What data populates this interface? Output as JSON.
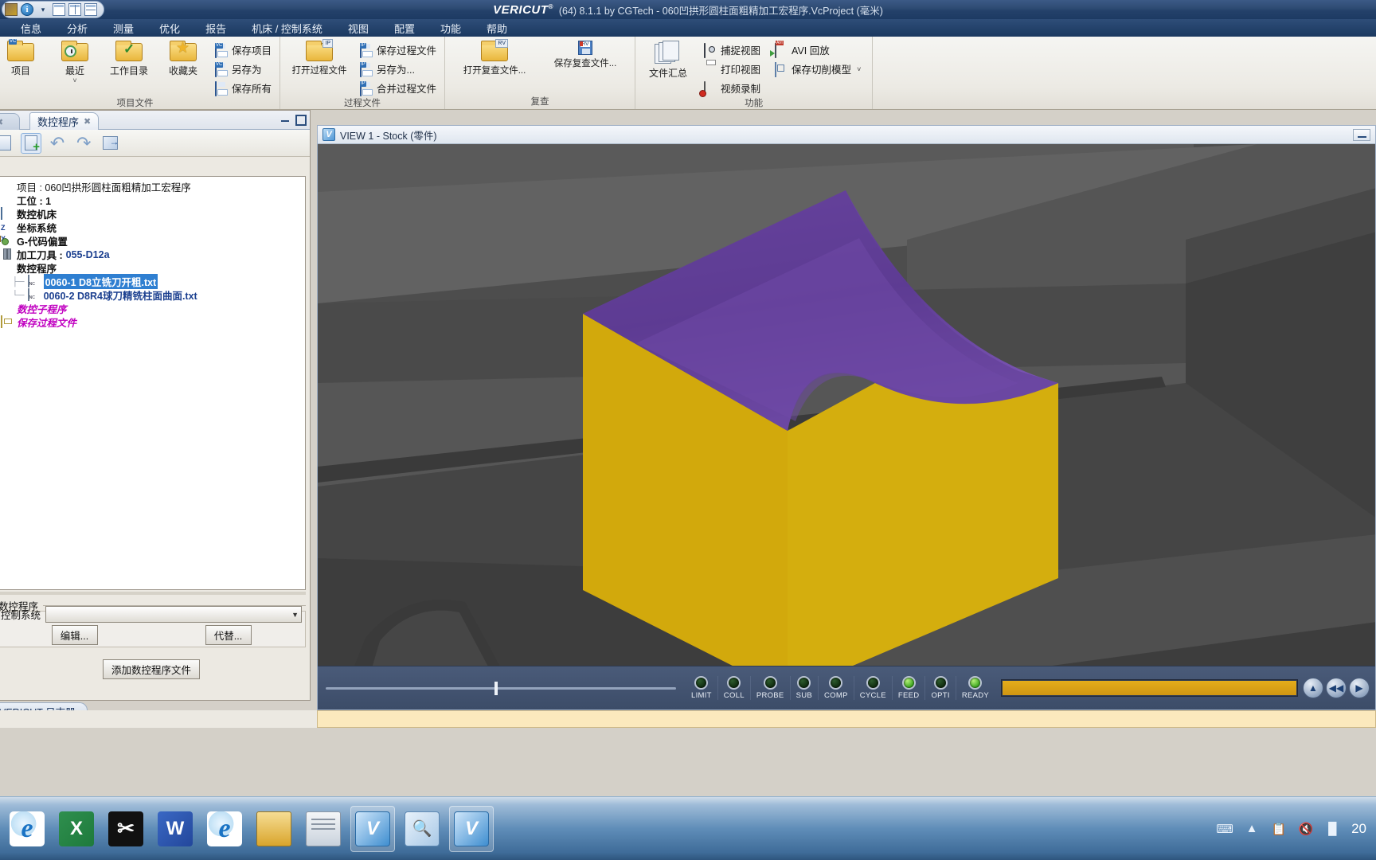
{
  "window": {
    "brand": "VERICUT",
    "brand_sup": "®",
    "title": "(64) 8.1.1 by CGTech - 060凹拱形圆柱面粗精加工宏程序.VcProject (毫米)"
  },
  "quick_access": {
    "icons": [
      "vericut-logo-icon",
      "info-icon",
      "chevron-down-icon",
      "single-pane-icon",
      "vertical-split-icon",
      "horizontal-split-icon"
    ]
  },
  "menubar": {
    "items": [
      {
        "label": "信息"
      },
      {
        "label": "分析"
      },
      {
        "label": "测量"
      },
      {
        "label": "优化"
      },
      {
        "label": "报告"
      },
      {
        "label": "机床 / 控制系统"
      },
      {
        "label": "视图"
      },
      {
        "label": "配置"
      },
      {
        "label": "功能"
      },
      {
        "label": "帮助"
      }
    ]
  },
  "ribbon": {
    "groups": [
      {
        "title": "项目文件",
        "big_buttons": [
          {
            "label": "项目",
            "icon": "folder-project-icon"
          },
          {
            "label": "最近",
            "icon": "folder-recent-icon",
            "caret": "˅"
          },
          {
            "label": "工作目录",
            "icon": "folder-check-icon"
          },
          {
            "label": "收藏夹",
            "icon": "folder-star-icon"
          }
        ],
        "small_buttons": [
          {
            "label": "保存项目",
            "icon": "save-vc-icon"
          },
          {
            "label": "另存为",
            "icon": "save-as-vc-icon"
          },
          {
            "label": "保存所有",
            "icon": "save-all-icon"
          }
        ]
      },
      {
        "title": "过程文件",
        "big_buttons": [
          {
            "label": "打开过程文件",
            "icon": "folder-ip-icon"
          }
        ],
        "small_buttons": [
          {
            "label": "保存过程文件",
            "icon": "save-ip-icon"
          },
          {
            "label": "另存为...",
            "icon": "save-as-ip-icon"
          },
          {
            "label": "合并过程文件",
            "icon": "merge-ip-icon"
          }
        ]
      },
      {
        "title": "复查",
        "big_buttons": [
          {
            "label": "打开复查文件...",
            "icon": "folder-rv-icon"
          },
          {
            "label": "保存复查文件...",
            "icon": "save-rv-icon"
          }
        ],
        "small_buttons": []
      },
      {
        "title": "功能",
        "big_buttons": [
          {
            "label": "文件汇总",
            "icon": "file-summary-icon"
          }
        ],
        "small_buttons": [
          {
            "label": "捕捉视图",
            "icon": "camera-icon"
          },
          {
            "label": "打印视图",
            "icon": "printer-icon"
          },
          {
            "label": "视频录制",
            "icon": "video-record-icon"
          }
        ],
        "small_buttons2": [
          {
            "label": "AVI 回放",
            "icon": "avi-play-icon"
          },
          {
            "label": "保存切削模型",
            "icon": "cube-save-icon",
            "caret": "˅"
          }
        ]
      }
    ]
  },
  "left_panel": {
    "tabs": [
      {
        "label": "",
        "close": "✖",
        "active": false
      },
      {
        "label": "数控程序",
        "close": "✖",
        "active": true
      }
    ],
    "window_controls": [
      "minimize-icon",
      "maximize-icon"
    ],
    "toolbar": [
      {
        "name": "new-doc-icon"
      },
      {
        "name": "add-doc-icon",
        "selected": true
      },
      {
        "name": "undo-icon"
      },
      {
        "name": "redo-icon"
      },
      {
        "name": "export-icon"
      }
    ],
    "tree": [
      {
        "indent": 0,
        "label": "项目 : 060凹拱形圆柱面粗精加工宏程序",
        "style": "plain",
        "icon": "project-icon"
      },
      {
        "indent": 0,
        "label": "工位 : 1",
        "style": "bold",
        "icon": "station-icon"
      },
      {
        "indent": 1,
        "label": "数控机床",
        "style": "bold",
        "icon": "machine-icon"
      },
      {
        "indent": 1,
        "label": "坐标系统",
        "style": "bold",
        "icon": "axis-icon"
      },
      {
        "indent": 1,
        "label": "G-代码偏置",
        "style": "bold",
        "icon": "gcode-offset-icon"
      },
      {
        "indent": 1,
        "label": "加工刀具 : 055-D12a",
        "style": "bold-blue-value",
        "icon": "tool-icon"
      },
      {
        "indent": 1,
        "label": "数控程序",
        "style": "bold",
        "icon": "nc-program-icon"
      },
      {
        "indent": 2,
        "label": "0060-1 D8立铣刀开粗.txt",
        "style": "selected",
        "icon": "nc-file-icon"
      },
      {
        "indent": 2,
        "label": "0060-2 D8R4球刀精铣柱面曲面.txt",
        "style": "blue",
        "icon": "nc-file-icon"
      },
      {
        "indent": 1,
        "label": "数控子程序",
        "style": "magenta",
        "icon": "sub-program-icon"
      },
      {
        "indent": 1,
        "label": "保存过程文件",
        "style": "magenta",
        "icon": "save-process-icon"
      }
    ],
    "tool_label_prefix": "加工刀具 : ",
    "tool_label_value": "055-D12a",
    "lower_section": {
      "legend": "数控程序",
      "control_label": "控制系统",
      "combo_value": "",
      "combo_arrow": "▼",
      "buttons": [
        {
          "label": "编辑..."
        },
        {
          "label": "代替..."
        }
      ],
      "add_button": {
        "label": "添加数控程序文件"
      }
    },
    "log_tab": {
      "label": "VERICUT 日志器"
    }
  },
  "view_panel": {
    "header": {
      "title": "VIEW 1 - Stock (零件)",
      "logo": "vericut-view-icon"
    },
    "minimize": "minimize-icon"
  },
  "playback": {
    "slider": {
      "position_percent": 48
    },
    "leds": [
      {
        "label": "LIMIT",
        "on": false
      },
      {
        "label": "COLL",
        "on": false
      },
      {
        "label": "PROBE",
        "on": false
      },
      {
        "label": "SUB",
        "on": false
      },
      {
        "label": "COMP",
        "on": false
      },
      {
        "label": "CYCLE",
        "on": false
      },
      {
        "label": "FEED",
        "on": true
      },
      {
        "label": "OPTI",
        "on": false
      },
      {
        "label": "READY",
        "on": true
      }
    ],
    "progress_percent": 100,
    "buttons": [
      {
        "name": "eject-button",
        "glyph": "▲"
      },
      {
        "name": "rewind-button",
        "glyph": "◀◀"
      },
      {
        "name": "play-button",
        "glyph": "▶"
      }
    ]
  },
  "colors": {
    "stock_top": "#6b3fa0",
    "stock_side": "#d4af0e",
    "machine_gray": "#4b4b4b",
    "accent_blue": "#2f7fd1",
    "progress_orange": "#d9a013",
    "status_strip": "#fbe9bd"
  },
  "taskbar": {
    "items": [
      {
        "name": "internet-explorer-icon"
      },
      {
        "name": "excel-icon"
      },
      {
        "name": "scissors-app-icon"
      },
      {
        "name": "word-icon"
      },
      {
        "name": "internet-explorer-2-icon"
      },
      {
        "name": "file-explorer-icon"
      },
      {
        "name": "notepad-icon"
      },
      {
        "name": "vericut-app-icon",
        "active": false
      },
      {
        "name": "vericut-toolmanager-icon"
      },
      {
        "name": "vericut-app-2-icon",
        "active": true
      }
    ],
    "tray": [
      {
        "name": "keyboard-icon",
        "glyph": "⌨"
      },
      {
        "name": "show-hidden-icons-icon",
        "glyph": "▲"
      },
      {
        "name": "clipboard-icon",
        "glyph": "Ὄb"
      },
      {
        "name": "volume-muted-icon",
        "glyph": "🔇"
      },
      {
        "name": "network-icon",
        "glyph": "▁▃▅"
      }
    ],
    "clock": "20"
  }
}
